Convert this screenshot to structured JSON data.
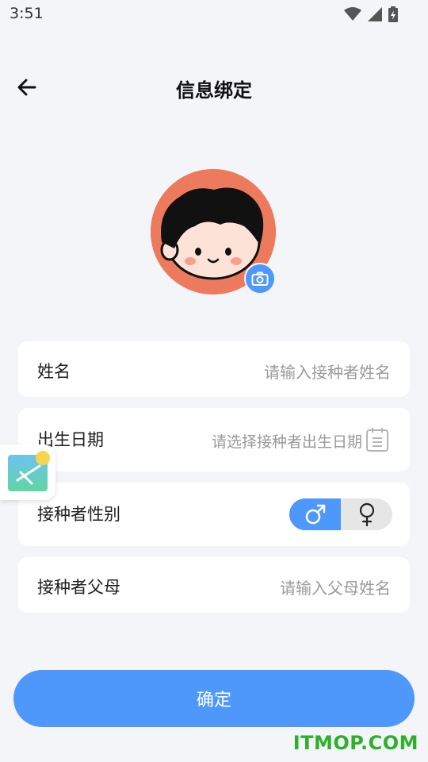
{
  "status_bar": {
    "time": "3:51"
  },
  "header": {
    "title": "信息绑定"
  },
  "form": {
    "name": {
      "label": "姓名",
      "placeholder": "请输入接种者姓名"
    },
    "birth": {
      "label": "出生日期",
      "placeholder": "请选择接种者出生日期"
    },
    "gender": {
      "label": "接种者性别",
      "male_symbol": "♂",
      "female_symbol": "♀",
      "selected": "male"
    },
    "parent": {
      "label": "接种者父母",
      "placeholder": "请输入父母姓名"
    }
  },
  "confirm_label": "确定",
  "watermark": "ITMOP.COM",
  "colors": {
    "accent": "#4f98fb",
    "avatar_bg": "#ee7a5d",
    "background": "#f4f5f9"
  },
  "icons": [
    "back-arrow-icon",
    "camera-icon",
    "calendar-icon",
    "wifi-icon",
    "signal-icon",
    "battery-icon",
    "image-icon"
  ]
}
